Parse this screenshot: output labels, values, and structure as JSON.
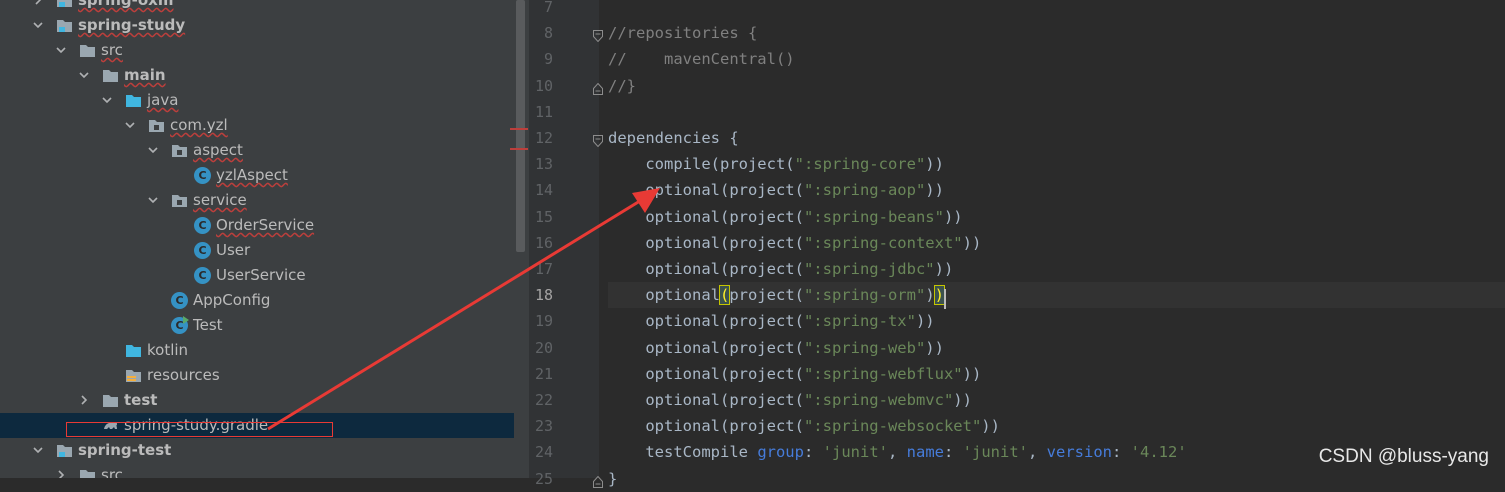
{
  "project_tree": {
    "rows": [
      {
        "label": "spring-oxm",
        "indent": 1,
        "chevron": "right",
        "icon": "module",
        "bold": true,
        "squiggle": true
      },
      {
        "label": "spring-study",
        "indent": 1,
        "chevron": "down",
        "icon": "module",
        "bold": true,
        "squiggle": true
      },
      {
        "label": "src",
        "indent": 2,
        "chevron": "down",
        "icon": "folder-gray",
        "squiggle": true
      },
      {
        "label": "main",
        "indent": 3,
        "chevron": "down",
        "icon": "folder-gray",
        "bold": true,
        "squiggle": true
      },
      {
        "label": "java",
        "indent": 4,
        "chevron": "down",
        "icon": "folder-blue",
        "squiggle": true
      },
      {
        "label": "com.yzl",
        "indent": 5,
        "chevron": "down",
        "icon": "package",
        "squiggle": true
      },
      {
        "label": "aspect",
        "indent": 6,
        "chevron": "down",
        "icon": "package",
        "squiggle": true
      },
      {
        "label": "yzlAspect",
        "indent": 7,
        "chevron": "none",
        "icon": "class",
        "squiggle": true
      },
      {
        "label": "service",
        "indent": 6,
        "chevron": "down",
        "icon": "package",
        "squiggle": true
      },
      {
        "label": "OrderService",
        "indent": 7,
        "chevron": "none",
        "icon": "class",
        "squiggle": true
      },
      {
        "label": "User",
        "indent": 7,
        "chevron": "none",
        "icon": "class"
      },
      {
        "label": "UserService",
        "indent": 7,
        "chevron": "none",
        "icon": "class"
      },
      {
        "label": "AppConfig",
        "indent": 6,
        "chevron": "none",
        "icon": "class"
      },
      {
        "label": "Test",
        "indent": 6,
        "chevron": "none",
        "icon": "class-run"
      },
      {
        "label": "kotlin",
        "indent": 4,
        "chevron": "none",
        "icon": "folder-blue"
      },
      {
        "label": "resources",
        "indent": 4,
        "chevron": "none",
        "icon": "folder-res"
      },
      {
        "label": "test",
        "indent": 3,
        "chevron": "right",
        "icon": "folder-gray",
        "bold": true
      },
      {
        "label": "spring-study.gradle",
        "indent": 3,
        "chevron": "none",
        "icon": "gradle",
        "selected": true
      },
      {
        "label": "spring-test",
        "indent": 1,
        "chevron": "down",
        "icon": "module",
        "bold": true
      },
      {
        "label": "src",
        "indent": 2,
        "chevron": "right",
        "icon": "folder-gray"
      }
    ]
  },
  "editor": {
    "current_line": "18",
    "lines": [
      {
        "n": "7",
        "segs": []
      },
      {
        "n": "8",
        "fold": "open",
        "segs": [
          {
            "t": "//repositories {",
            "c": "comment"
          }
        ]
      },
      {
        "n": "9",
        "segs": [
          {
            "t": "//    mavenCentral()",
            "c": "comment"
          }
        ]
      },
      {
        "n": "10",
        "fold": "close",
        "segs": [
          {
            "t": "//}",
            "c": "comment"
          }
        ]
      },
      {
        "n": "11",
        "segs": []
      },
      {
        "n": "12",
        "fold": "open",
        "segs": [
          {
            "t": "dependencies {",
            "c": ""
          }
        ]
      },
      {
        "n": "13",
        "segs": [
          {
            "t": "    compile(project(",
            "c": ""
          },
          {
            "t": "\":spring-core\"",
            "c": "str"
          },
          {
            "t": "))",
            "c": ""
          }
        ]
      },
      {
        "n": "14",
        "segs": [
          {
            "t": "    optional(project(",
            "c": ""
          },
          {
            "t": "\":spring-aop\"",
            "c": "str"
          },
          {
            "t": "))",
            "c": ""
          }
        ]
      },
      {
        "n": "15",
        "segs": [
          {
            "t": "    optional(project(",
            "c": ""
          },
          {
            "t": "\":spring-beans\"",
            "c": "str"
          },
          {
            "t": "))",
            "c": ""
          }
        ]
      },
      {
        "n": "16",
        "segs": [
          {
            "t": "    optional(project(",
            "c": ""
          },
          {
            "t": "\":spring-context\"",
            "c": "str"
          },
          {
            "t": "))",
            "c": ""
          }
        ]
      },
      {
        "n": "17",
        "segs": [
          {
            "t": "    optional(project(",
            "c": ""
          },
          {
            "t": "\":spring-jdbc\"",
            "c": "str"
          },
          {
            "t": "))",
            "c": ""
          }
        ]
      },
      {
        "n": "18",
        "segs": [
          {
            "t": "    optional",
            "c": ""
          },
          {
            "t": "(",
            "c": "brace-hi"
          },
          {
            "t": "project(",
            "c": ""
          },
          {
            "t": "\":spring-orm\"",
            "c": "str"
          },
          {
            "t": ")",
            "c": ""
          },
          {
            "t": ")",
            "c": "brace-hi"
          }
        ]
      },
      {
        "n": "19",
        "segs": [
          {
            "t": "    optional(project(",
            "c": ""
          },
          {
            "t": "\":spring-tx\"",
            "c": "str"
          },
          {
            "t": "))",
            "c": ""
          }
        ]
      },
      {
        "n": "20",
        "segs": [
          {
            "t": "    optional(project(",
            "c": ""
          },
          {
            "t": "\":spring-web\"",
            "c": "str"
          },
          {
            "t": "))",
            "c": ""
          }
        ]
      },
      {
        "n": "21",
        "segs": [
          {
            "t": "    optional(project(",
            "c": ""
          },
          {
            "t": "\":spring-webflux\"",
            "c": "str"
          },
          {
            "t": "))",
            "c": ""
          }
        ]
      },
      {
        "n": "22",
        "segs": [
          {
            "t": "    optional(project(",
            "c": ""
          },
          {
            "t": "\":spring-webmvc\"",
            "c": "str"
          },
          {
            "t": "))",
            "c": ""
          }
        ]
      },
      {
        "n": "23",
        "segs": [
          {
            "t": "    optional(project(",
            "c": ""
          },
          {
            "t": "\":spring-websocket\"",
            "c": "str"
          },
          {
            "t": "))",
            "c": ""
          }
        ]
      },
      {
        "n": "24",
        "segs": [
          {
            "t": "    testCompile ",
            "c": ""
          },
          {
            "t": "group",
            "c": "named"
          },
          {
            "t": ": ",
            "c": ""
          },
          {
            "t": "'junit'",
            "c": "str"
          },
          {
            "t": ", ",
            "c": ""
          },
          {
            "t": "name",
            "c": "named"
          },
          {
            "t": ": ",
            "c": ""
          },
          {
            "t": "'junit'",
            "c": "str"
          },
          {
            "t": ", ",
            "c": ""
          },
          {
            "t": "version",
            "c": "named"
          },
          {
            "t": ": ",
            "c": ""
          },
          {
            "t": "'4.12'",
            "c": "str"
          }
        ]
      },
      {
        "n": "25",
        "fold": "close",
        "segs": [
          {
            "t": "}",
            "c": ""
          }
        ]
      }
    ]
  },
  "colors": {
    "tree_bg": "#3c3f41",
    "editor_bg": "#2b2b2b",
    "selection": "#0d293e",
    "annotation": "#e83a35",
    "string": "#6a8759",
    "comment": "#808080"
  },
  "watermark": "CSDN @bluss-yang"
}
